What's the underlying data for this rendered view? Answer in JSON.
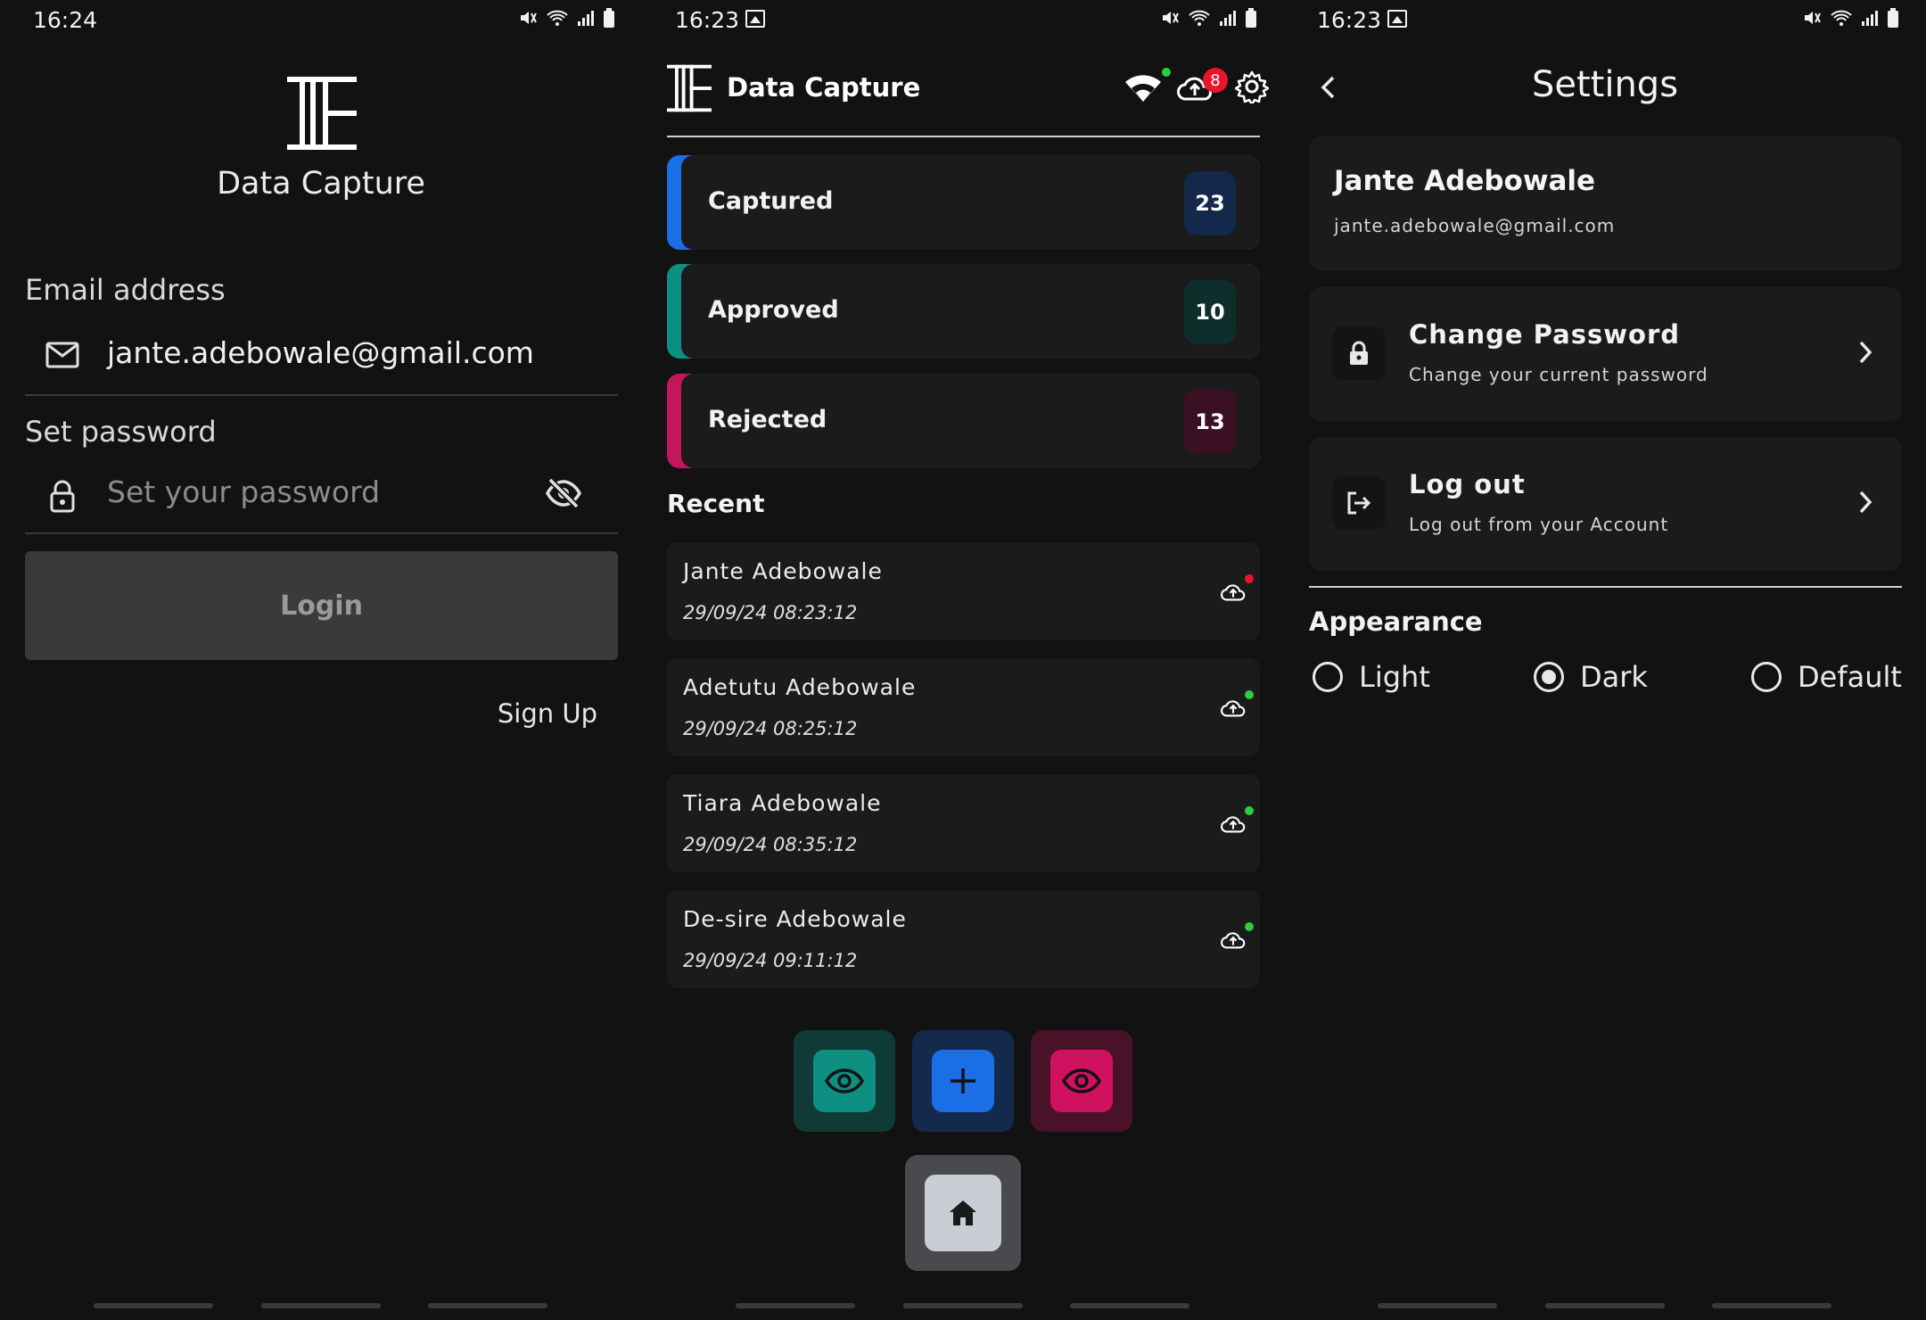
{
  "screens": {
    "login": {
      "status_time": "16:24",
      "app_name": "Data Capture",
      "email_label": "Email address",
      "email_value": "jante.adebowale@gmail.com",
      "password_label": "Set password",
      "password_placeholder": "Set your password",
      "login_label": "Login",
      "signup_label": "Sign Up"
    },
    "dashboard": {
      "status_time": "16:23",
      "app_name": "Data Capture",
      "upload_badge": "8",
      "stats": [
        {
          "label": "Captured",
          "count": "23",
          "accent": "#1a6ee6",
          "badge_bg": "#13284a"
        },
        {
          "label": "Approved",
          "count": "10",
          "accent": "#0d8f82",
          "badge_bg": "#0e2e2b"
        },
        {
          "label": "Rejected",
          "count": "13",
          "accent": "#c2185b",
          "badge_bg": "#3a1022"
        }
      ],
      "recent_title": "Recent",
      "recent": [
        {
          "name": "Jante Adebowale",
          "time": "29/09/24 08:23:12",
          "sync": "#e8162c"
        },
        {
          "name": "Adetutu Adebowale",
          "time": "29/09/24 08:25:12",
          "sync": "#2ecc40"
        },
        {
          "name": "Tiara Adebowale",
          "time": "29/09/24 08:35:12",
          "sync": "#2ecc40"
        },
        {
          "name": "De-sire Adebowale",
          "time": "29/09/24 09:11:12",
          "sync": "#2ecc40"
        }
      ],
      "actions": [
        {
          "icon": "eye-icon",
          "outer": "#0f3a35",
          "inner": "#0d8f82"
        },
        {
          "icon": "plus-icon",
          "outer": "#142a4d",
          "inner": "#1a6ee6"
        },
        {
          "icon": "eye-icon",
          "outer": "#4a1228",
          "inner": "#d0115f"
        }
      ]
    },
    "settings": {
      "status_time": "16:23",
      "title": "Settings",
      "user_name": "Jante Adebowale",
      "user_email": "jante.adebowale@gmail.com",
      "change_password_title": "Change Password",
      "change_password_sub": "Change your current password",
      "logout_title": "Log out",
      "logout_sub": "Log out from your Account",
      "appearance_label": "Appearance",
      "themes": [
        {
          "label": "Light",
          "selected": false
        },
        {
          "label": "Dark",
          "selected": true
        },
        {
          "label": "Default",
          "selected": false
        }
      ]
    }
  }
}
